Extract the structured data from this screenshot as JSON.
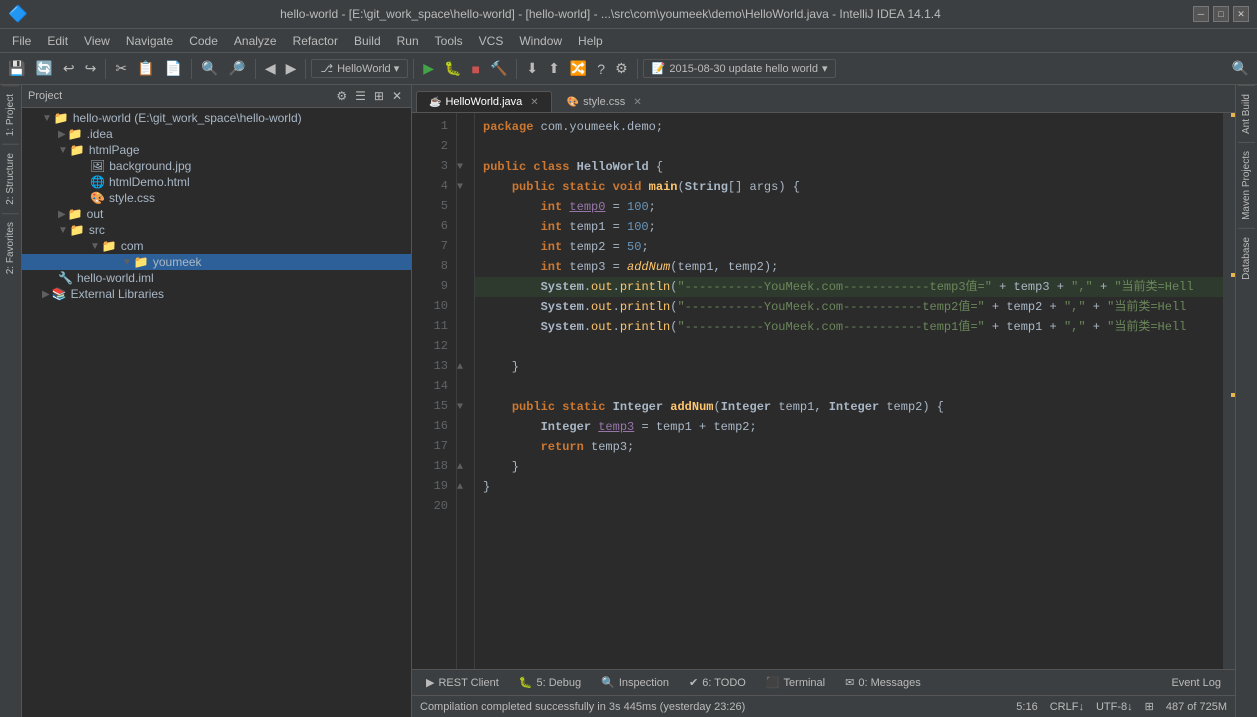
{
  "titleBar": {
    "text": "hello-world - [E:\\git_work_space\\hello-world] - [hello-world] - ...\\src\\com\\youmeek\\demo\\HelloWorld.java - IntelliJ IDEA 14.1.4"
  },
  "menuBar": {
    "items": [
      "File",
      "Edit",
      "View",
      "Navigate",
      "Code",
      "Analyze",
      "Refactor",
      "Build",
      "Run",
      "Tools",
      "VCS",
      "Window",
      "Help"
    ]
  },
  "toolbar": {
    "branch": "2015-08-30 update hello world"
  },
  "tabs": {
    "open": [
      {
        "label": "HelloWorld.java",
        "icon": "☕",
        "active": true
      },
      {
        "label": "style.css",
        "icon": "🎨",
        "active": false
      }
    ]
  },
  "projectPanel": {
    "title": "Project",
    "tree": [
      {
        "indent": 0,
        "icon": "📁",
        "label": "hello-world (E:\\git_work_space\\hello-world)",
        "expanded": true,
        "selected": false
      },
      {
        "indent": 1,
        "icon": "📁",
        "label": ".idea",
        "expanded": false,
        "selected": false
      },
      {
        "indent": 1,
        "icon": "📁",
        "label": "htmlPage",
        "expanded": true,
        "selected": false
      },
      {
        "indent": 2,
        "icon": "🖼",
        "label": "background.jpg",
        "expanded": false,
        "selected": false
      },
      {
        "indent": 2,
        "icon": "🌐",
        "label": "htmlDemo.html",
        "expanded": false,
        "selected": false
      },
      {
        "indent": 2,
        "icon": "🎨",
        "label": "style.css",
        "expanded": false,
        "selected": false
      },
      {
        "indent": 1,
        "icon": "📁",
        "label": "out",
        "expanded": false,
        "selected": false
      },
      {
        "indent": 1,
        "icon": "📁",
        "label": "src",
        "expanded": true,
        "selected": false
      },
      {
        "indent": 2,
        "icon": "📁",
        "label": "com",
        "expanded": true,
        "selected": false
      },
      {
        "indent": 3,
        "icon": "📁",
        "label": "youmeek",
        "expanded": true,
        "selected": true
      },
      {
        "indent": 1,
        "icon": "📄",
        "label": "hello-world.iml",
        "expanded": false,
        "selected": false
      },
      {
        "indent": 0,
        "icon": "📚",
        "label": "External Libraries",
        "expanded": false,
        "selected": false
      }
    ]
  },
  "codeEditor": {
    "filename": "HelloWorld.java",
    "lines": [
      {
        "num": 1,
        "content": "package com.youmeek.demo;"
      },
      {
        "num": 2,
        "content": ""
      },
      {
        "num": 3,
        "content": "public class HelloWorld {"
      },
      {
        "num": 4,
        "content": "    public static void main(String[] args) {"
      },
      {
        "num": 5,
        "content": "        int temp0 = 100;"
      },
      {
        "num": 6,
        "content": "        int temp1 = 100;"
      },
      {
        "num": 7,
        "content": "        int temp2 = 50;"
      },
      {
        "num": 8,
        "content": "        int temp3 = addNum(temp1, temp2);"
      },
      {
        "num": 9,
        "content": "        System.out.println(\"-----------YouMeek.com------------temp3值=\" + temp3 + \",\" + \"当前类=Hell"
      },
      {
        "num": 10,
        "content": "        System.out.println(\"-----------YouMeek.com-----------temp2值=\" + temp2 + \",\" + \"当前类=Hell"
      },
      {
        "num": 11,
        "content": "        System.out.println(\"-----------YouMeek.com-----------temp1值=\" + temp1 + \",\" + \"当前类=Hell"
      },
      {
        "num": 12,
        "content": ""
      },
      {
        "num": 13,
        "content": "    }"
      },
      {
        "num": 14,
        "content": ""
      },
      {
        "num": 15,
        "content": "    public static Integer addNum(Integer temp1, Integer temp2) {"
      },
      {
        "num": 16,
        "content": "        Integer temp3 = temp1 + temp2;"
      },
      {
        "num": 17,
        "content": "        return temp3;"
      },
      {
        "num": 18,
        "content": "    }"
      },
      {
        "num": 19,
        "content": "}"
      },
      {
        "num": 20,
        "content": ""
      }
    ]
  },
  "sideTabs": {
    "left": [
      "1: Project",
      "2: Structure",
      "2: Favorites"
    ],
    "right": [
      "Ant Build",
      "Maven Projects",
      "Database"
    ]
  },
  "bottomTabs": [
    {
      "icon": "▶",
      "label": "REST Client",
      "badge": ""
    },
    {
      "icon": "🐛",
      "label": "5: Debug",
      "badge": "5"
    },
    {
      "icon": "🔍",
      "label": "Inspection",
      "badge": ""
    },
    {
      "icon": "✔",
      "label": "6: TODO",
      "badge": "6"
    },
    {
      "icon": "⬛",
      "label": "Terminal",
      "badge": ""
    },
    {
      "icon": "✉",
      "label": "0: Messages",
      "badge": "0"
    }
  ],
  "statusBar": {
    "message": "Compilation completed successfully in 3s 445ms (yesterday 23:26)",
    "position": "5:16",
    "encoding": "CRLF↓  UTF-8↓",
    "lineCol": "487 of 725M",
    "eventLog": "Event Log"
  }
}
